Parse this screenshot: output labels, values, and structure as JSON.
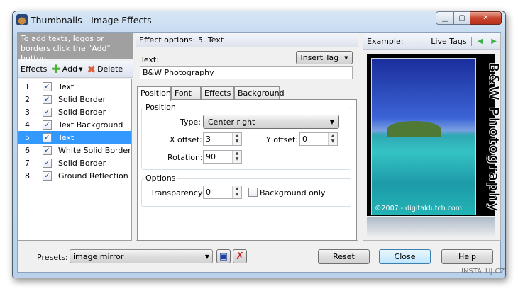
{
  "window": {
    "title": "Thumbnails - Image Effects"
  },
  "left": {
    "hint": "To add texts, logos or borders click the \"Add\" button.",
    "effects_label": "Effects",
    "add_label": "Add",
    "delete_label": "Delete",
    "items": [
      {
        "n": "1",
        "label": "Text"
      },
      {
        "n": "2",
        "label": "Solid Border"
      },
      {
        "n": "3",
        "label": "Solid Border"
      },
      {
        "n": "4",
        "label": "Text Background"
      },
      {
        "n": "5",
        "label": "Text"
      },
      {
        "n": "6",
        "label": "White Solid Border"
      },
      {
        "n": "7",
        "label": "Solid Border"
      },
      {
        "n": "8",
        "label": "Ground Reflection"
      }
    ],
    "selected_index": 4
  },
  "middle": {
    "header": "Effect options: 5. Text",
    "text_label": "Text:",
    "insert_tag": "Insert Tag",
    "text_value": "B&W Photography",
    "tabs": [
      "Position",
      "Font",
      "Effects",
      "Background"
    ],
    "position_group": "Position",
    "type_label": "Type:",
    "type_value": "Center right",
    "x_label": "X offset:",
    "x_value": "3",
    "y_label": "Y offset:",
    "y_value": "0",
    "rotation_label": "Rotation:",
    "rotation_value": "90",
    "options_group": "Options",
    "transparency_label": "Transparency:",
    "transparency_value": "0",
    "bg_only_label": "Background only"
  },
  "right": {
    "example_label": "Example:",
    "live_tags": "Live Tags",
    "overlay_text": "B&W Photography",
    "copyright": "©2007 - digitaldutch.com"
  },
  "bottom": {
    "presets_label": "Presets:",
    "presets_value": "image mirror",
    "reset": "Reset",
    "close": "Close",
    "help": "Help"
  },
  "watermark": "INSTALUJ.CZ"
}
